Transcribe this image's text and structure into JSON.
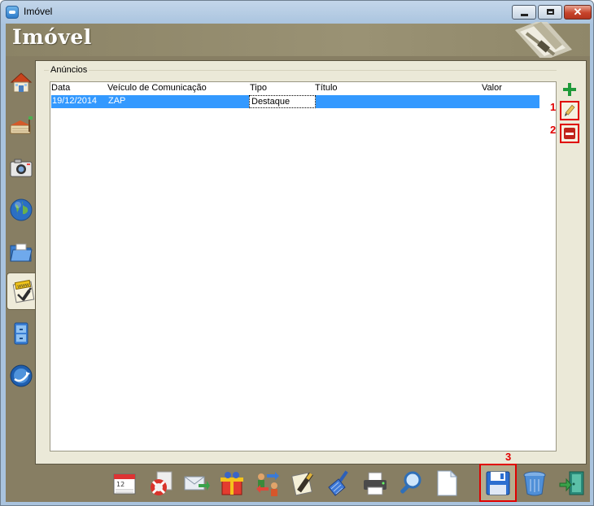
{
  "window": {
    "title": "Imóvel",
    "min_glyph": "",
    "max_glyph": "",
    "close_glyph": "✕"
  },
  "header": {
    "title": "Imóvel",
    "logo_icon": "ruler-pencil-logo-icon"
  },
  "sidebar": {
    "items": [
      {
        "icon": "house-icon"
      },
      {
        "icon": "land-sale-icon"
      },
      {
        "icon": "camera-icon"
      },
      {
        "icon": "globe-icon"
      },
      {
        "icon": "folder-icon"
      },
      {
        "icon": "www-certificate-icon",
        "active": true
      },
      {
        "icon": "cabinet-icon"
      },
      {
        "icon": "globe-arrow-icon"
      }
    ]
  },
  "anuncios": {
    "group_label": "Anúncios",
    "columns": [
      "Data",
      "Veículo de Comunicação",
      "Tipo",
      "Título",
      "Valor"
    ],
    "rows": [
      {
        "data": "19/12/2014",
        "veiculo": "ZAP",
        "tipo": "Destaque",
        "titulo": "",
        "valor": ""
      }
    ]
  },
  "annotations": {
    "marker_1": "1",
    "marker_2": "2",
    "marker_3": "3"
  },
  "actions": {
    "add_icon": "plus-icon",
    "edit_icon": "pencil-icon",
    "remove_icon": "minus-icon"
  },
  "toolbar": {
    "items": [
      {
        "icon": "calendar-icon"
      },
      {
        "icon": "lifebuoy-icon"
      },
      {
        "icon": "envelope-arrow-icon"
      },
      {
        "icon": "gift-icon"
      },
      {
        "icon": "transfer-users-icon"
      },
      {
        "icon": "certificate-pen-icon"
      },
      {
        "icon": "broom-icon"
      },
      {
        "icon": "printer-icon"
      },
      {
        "icon": "magnifier-icon"
      },
      {
        "icon": "new-document-icon"
      },
      {
        "icon": "floppy-disk-icon",
        "highlight": true
      },
      {
        "icon": "trash-icon"
      },
      {
        "icon": "exit-door-icon"
      }
    ],
    "calendar_day": "12"
  },
  "colors": {
    "accent": "#3399ff",
    "annotation": "#e00000",
    "panel_bg": "#877e63",
    "content_bg": "#ebe9d8"
  }
}
